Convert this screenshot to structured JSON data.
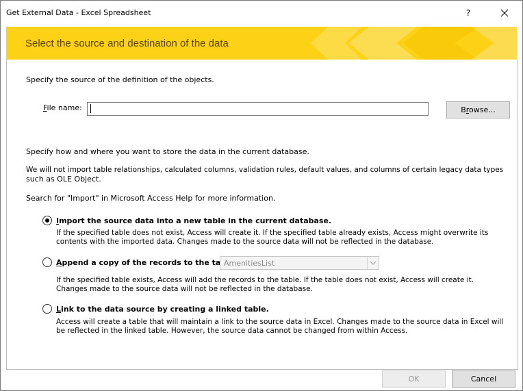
{
  "window": {
    "title": "Get External Data - Excel Spreadsheet",
    "help_label": "?",
    "close_icon": "close-icon"
  },
  "banner": {
    "heading": "Select the source and destination of the data",
    "color": "#fcd116"
  },
  "source": {
    "intro": "Specify the source of the definition of the objects.",
    "file_label_accel": "F",
    "file_label_rest": "ile name:",
    "file_value": "",
    "browse_accel_pre": "B",
    "browse_accel": "r",
    "browse_rest": "owse..."
  },
  "store": {
    "intro": "Specify how and where you want to store the data in the current database.",
    "note_line1": "We will not import table relationships, calculated columns, validation rules, default values, and columns of certain legacy data types",
    "note_line2": "such as OLE Object.",
    "search_hint": "Search for \"Import\" in Microsoft Access Help for more information."
  },
  "options": {
    "import": {
      "accel": "I",
      "label_rest": "mport the source data into a new table in the current database.",
      "desc_line1": "If the specified table does not exist, Access will create it. If the specified table already exists, Access might overwrite its",
      "desc_line2": "contents with the imported data. Changes made to the source data will not be reflected in the database.",
      "selected": true
    },
    "append": {
      "accel": "A",
      "label_rest": "ppend a copy of the records to the table:",
      "table_value": "AmenitiesList",
      "desc_line1": "If the specified table exists, Access will add the records to the table. If the table does not exist, Access will create it.",
      "desc_line2": "Changes made to the source data will not be reflected in the database.",
      "selected": false
    },
    "link": {
      "accel": "L",
      "label_rest": "ink to the data source by creating a linked table.",
      "desc_line1": "Access will create a table that will maintain a link to the source data in Excel. Changes made to the source data in Excel will",
      "desc_line2": "be reflected in the linked table. However, the source data cannot be changed from within Access.",
      "selected": false
    }
  },
  "footer": {
    "ok_label": "OK",
    "cancel_label": "Cancel"
  }
}
